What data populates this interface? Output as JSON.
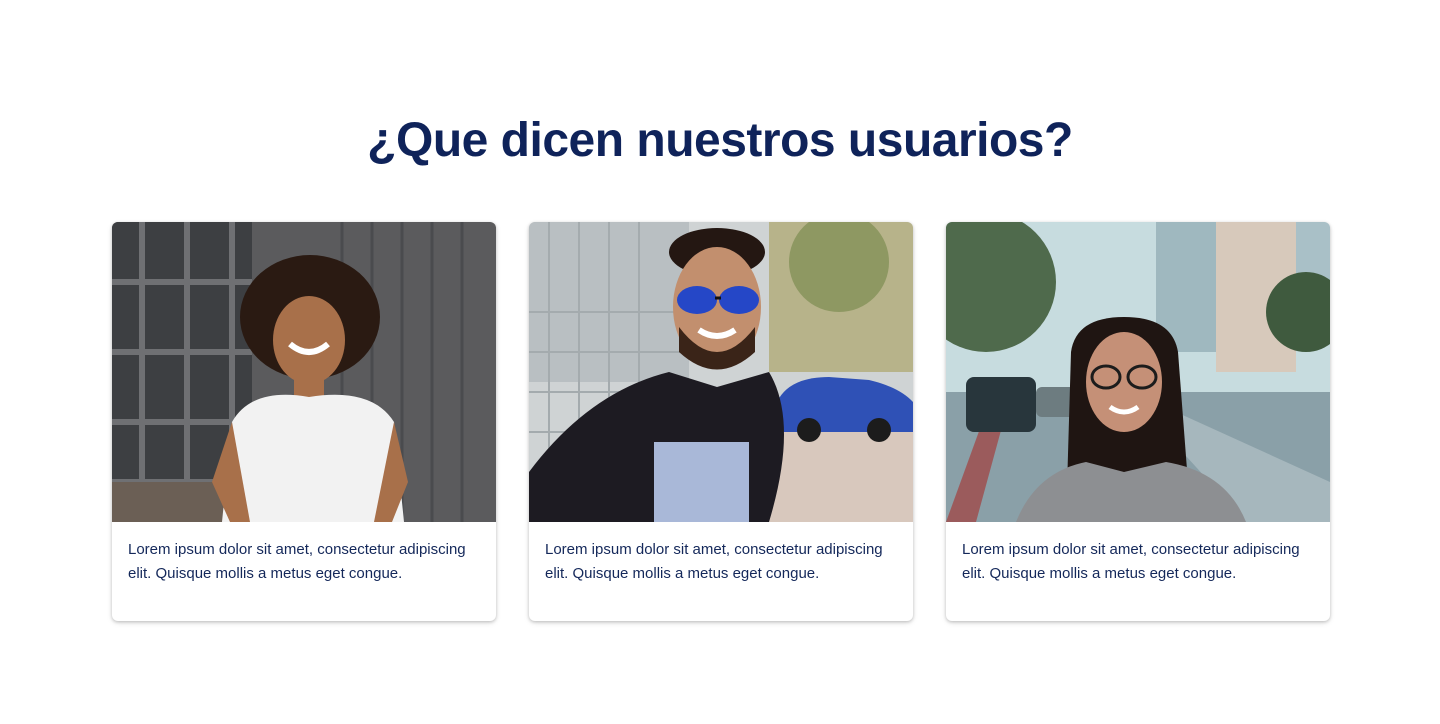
{
  "section": {
    "title": "¿Que dicen nuestros usuarios?"
  },
  "testimonials": [
    {
      "photo_icon": "smiling-woman-curly-hair-photo",
      "text": "Lorem ipsum dolor sit amet, consectetur adipiscing elit. Quisque mollis a metus eget congue."
    },
    {
      "photo_icon": "smiling-man-sunglasses-photo",
      "text": "Lorem ipsum dolor sit amet, consectetur adipiscing elit. Quisque mollis a metus eget congue."
    },
    {
      "photo_icon": "smiling-woman-glasses-street-photo",
      "text": "Lorem ipsum dolor sit amet, consectetur adipiscing elit. Quisque mollis a metus eget congue."
    }
  ],
  "colors": {
    "heading": "#0f235a",
    "body_text": "#14285a"
  }
}
